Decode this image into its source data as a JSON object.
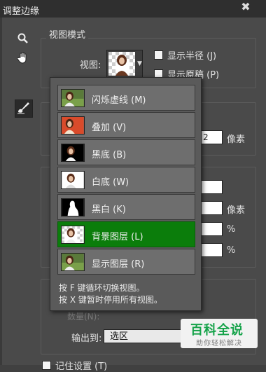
{
  "window": {
    "title": "调整边缘",
    "close_glyph": "✖"
  },
  "toolbar": {
    "zoom_icon": "magnifier-icon",
    "hand_icon": "hand-icon",
    "brush_icon": "refine-radius-brush-icon"
  },
  "view_mode": {
    "group_title": "视图模式",
    "view_label": "视图:",
    "show_radius_label": "显示半径 (J)",
    "show_original_label": "显示原稿 (P)"
  },
  "fields": {
    "radius_value": "2",
    "radius_unit": "像素",
    "unit_px": "像素",
    "unit_pct_1": "%",
    "unit_pct_2": "%"
  },
  "popup": {
    "items": [
      {
        "label": "闪烁虚线 (M)",
        "selected": false
      },
      {
        "label": "叠加 (V)",
        "selected": false
      },
      {
        "label": "黑底 (B)",
        "selected": false
      },
      {
        "label": "白底 (W)",
        "selected": false
      },
      {
        "label": "黑白 (K)",
        "selected": false
      },
      {
        "label": "背景图层 (L)",
        "selected": true
      },
      {
        "label": "显示图层 (R)",
        "selected": false
      }
    ],
    "hint_1": "按 F 键循环切换视图。",
    "hint_2": "按 X 键暂时停用所有视图。"
  },
  "output": {
    "amount_label": "数量(N):",
    "output_to_label": "输出到:",
    "output_to_value": "选区",
    "remember_label": "记住设置 (T)"
  },
  "watermark": {
    "title": "百科全说",
    "subtitle": "助你轻松解决"
  },
  "colors": {
    "selected": "#0b7d0b",
    "accent_green": "#16a34a"
  }
}
